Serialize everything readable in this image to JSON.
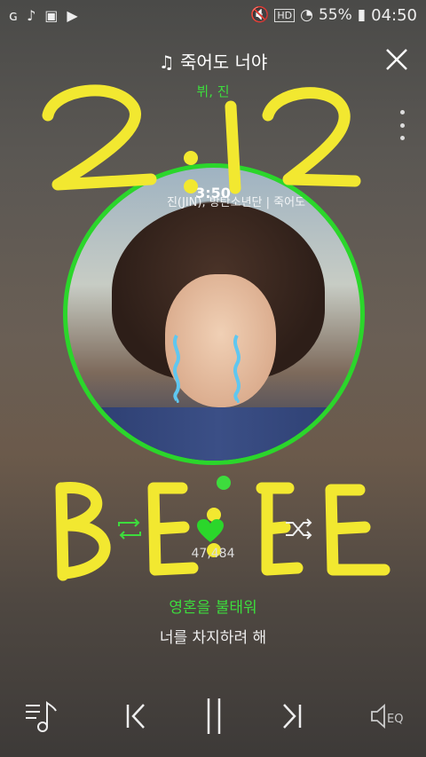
{
  "status_bar": {
    "battery": "55%",
    "time": "04:50",
    "left_icons": [
      "g-icon",
      "music-icon",
      "image-icon",
      "youtube-icon"
    ],
    "right_icons": [
      "mute-icon",
      "hd-icon",
      "wifi-icon",
      "charging-icon"
    ]
  },
  "player": {
    "song_title": "죽어도 너야",
    "artist": "뷔, 진",
    "album_overlay": "진(JIN), 방탄소년단 | 죽어도",
    "elapsed": "3:50",
    "like_count": "47,484",
    "lyric_current": "영혼을 불태워",
    "lyric_next": "너를 차지하려 해"
  },
  "doodles": {
    "top_text": "2:12",
    "bottom_text": "BE:E"
  },
  "colors": {
    "accent": "#3ddc3d",
    "doodle": "#f2e830",
    "tear": "#5fc7f0"
  }
}
